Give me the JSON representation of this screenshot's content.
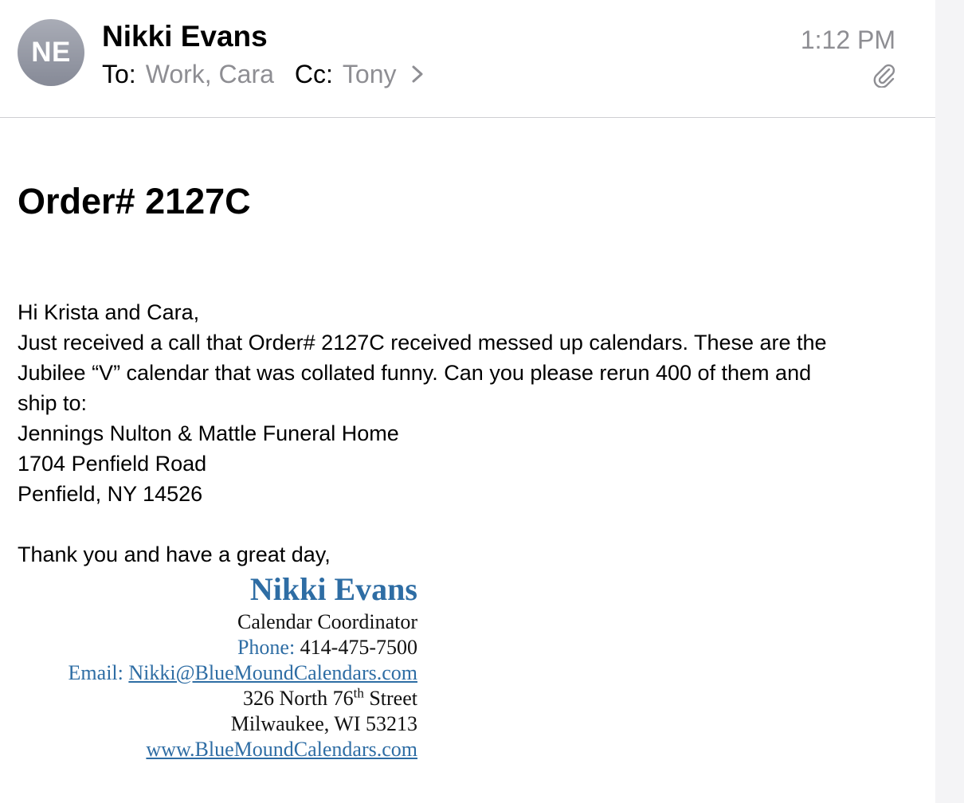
{
  "header": {
    "avatar_initials": "NE",
    "sender_name": "Nikki Evans",
    "to_label": "To:",
    "to_value": "Work, Cara",
    "cc_label": "Cc:",
    "cc_value": "Tony",
    "time": "1:12 PM",
    "attachment_icon": "paperclip-icon",
    "expand_icon": "chevron-right-icon"
  },
  "subject": "Order# 2127C",
  "body": {
    "lines": [
      "Hi Krista and Cara,",
      "Just received a call that Order# 2127C received messed up calendars. These are the",
      "Jubilee “V” calendar that was collated funny. Can you please rerun 400 of them and",
      "ship to:",
      "Jennings Nulton & Mattle Funeral Home",
      "1704 Penfield Road",
      "Penfield, NY 14526"
    ],
    "closing": "Thank you and have a great day,"
  },
  "signature": {
    "name": "Nikki Evans",
    "title": "Calendar Coordinator",
    "phone_label": "Phone:",
    "phone": "414-475-7500",
    "email_label": "Email:",
    "email": "Nikki@BlueMoundCalendars.com",
    "address_pre": "326 North 76",
    "address_sup": "th",
    "address_post": "Street",
    "city_line": "Milwaukee, WI 53213",
    "website": "www.BlueMoundCalendars.com"
  },
  "colors": {
    "signature_blue": "#2e6da4",
    "secondary_gray": "#8e8e93",
    "avatar_gray": "#9a9da8"
  }
}
